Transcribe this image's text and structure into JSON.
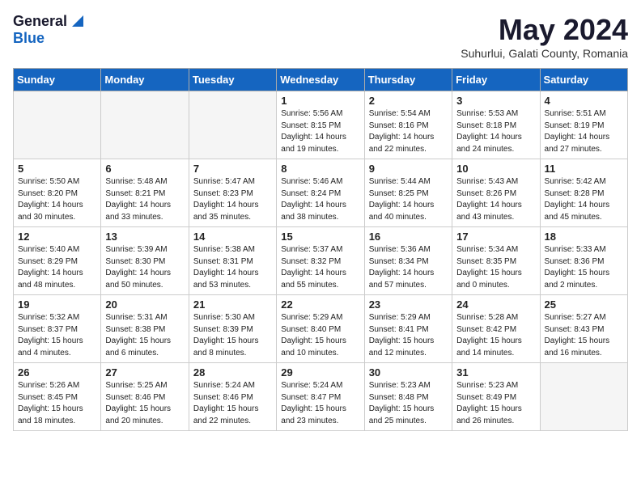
{
  "logo": {
    "general": "General",
    "blue": "Blue"
  },
  "title": "May 2024",
  "location": "Suhurlui, Galati County, Romania",
  "days_of_week": [
    "Sunday",
    "Monday",
    "Tuesday",
    "Wednesday",
    "Thursday",
    "Friday",
    "Saturday"
  ],
  "weeks": [
    [
      {
        "num": "",
        "info": ""
      },
      {
        "num": "",
        "info": ""
      },
      {
        "num": "",
        "info": ""
      },
      {
        "num": "1",
        "info": "Sunrise: 5:56 AM\nSunset: 8:15 PM\nDaylight: 14 hours\nand 19 minutes."
      },
      {
        "num": "2",
        "info": "Sunrise: 5:54 AM\nSunset: 8:16 PM\nDaylight: 14 hours\nand 22 minutes."
      },
      {
        "num": "3",
        "info": "Sunrise: 5:53 AM\nSunset: 8:18 PM\nDaylight: 14 hours\nand 24 minutes."
      },
      {
        "num": "4",
        "info": "Sunrise: 5:51 AM\nSunset: 8:19 PM\nDaylight: 14 hours\nand 27 minutes."
      }
    ],
    [
      {
        "num": "5",
        "info": "Sunrise: 5:50 AM\nSunset: 8:20 PM\nDaylight: 14 hours\nand 30 minutes."
      },
      {
        "num": "6",
        "info": "Sunrise: 5:48 AM\nSunset: 8:21 PM\nDaylight: 14 hours\nand 33 minutes."
      },
      {
        "num": "7",
        "info": "Sunrise: 5:47 AM\nSunset: 8:23 PM\nDaylight: 14 hours\nand 35 minutes."
      },
      {
        "num": "8",
        "info": "Sunrise: 5:46 AM\nSunset: 8:24 PM\nDaylight: 14 hours\nand 38 minutes."
      },
      {
        "num": "9",
        "info": "Sunrise: 5:44 AM\nSunset: 8:25 PM\nDaylight: 14 hours\nand 40 minutes."
      },
      {
        "num": "10",
        "info": "Sunrise: 5:43 AM\nSunset: 8:26 PM\nDaylight: 14 hours\nand 43 minutes."
      },
      {
        "num": "11",
        "info": "Sunrise: 5:42 AM\nSunset: 8:28 PM\nDaylight: 14 hours\nand 45 minutes."
      }
    ],
    [
      {
        "num": "12",
        "info": "Sunrise: 5:40 AM\nSunset: 8:29 PM\nDaylight: 14 hours\nand 48 minutes."
      },
      {
        "num": "13",
        "info": "Sunrise: 5:39 AM\nSunset: 8:30 PM\nDaylight: 14 hours\nand 50 minutes."
      },
      {
        "num": "14",
        "info": "Sunrise: 5:38 AM\nSunset: 8:31 PM\nDaylight: 14 hours\nand 53 minutes."
      },
      {
        "num": "15",
        "info": "Sunrise: 5:37 AM\nSunset: 8:32 PM\nDaylight: 14 hours\nand 55 minutes."
      },
      {
        "num": "16",
        "info": "Sunrise: 5:36 AM\nSunset: 8:34 PM\nDaylight: 14 hours\nand 57 minutes."
      },
      {
        "num": "17",
        "info": "Sunrise: 5:34 AM\nSunset: 8:35 PM\nDaylight: 15 hours\nand 0 minutes."
      },
      {
        "num": "18",
        "info": "Sunrise: 5:33 AM\nSunset: 8:36 PM\nDaylight: 15 hours\nand 2 minutes."
      }
    ],
    [
      {
        "num": "19",
        "info": "Sunrise: 5:32 AM\nSunset: 8:37 PM\nDaylight: 15 hours\nand 4 minutes."
      },
      {
        "num": "20",
        "info": "Sunrise: 5:31 AM\nSunset: 8:38 PM\nDaylight: 15 hours\nand 6 minutes."
      },
      {
        "num": "21",
        "info": "Sunrise: 5:30 AM\nSunset: 8:39 PM\nDaylight: 15 hours\nand 8 minutes."
      },
      {
        "num": "22",
        "info": "Sunrise: 5:29 AM\nSunset: 8:40 PM\nDaylight: 15 hours\nand 10 minutes."
      },
      {
        "num": "23",
        "info": "Sunrise: 5:29 AM\nSunset: 8:41 PM\nDaylight: 15 hours\nand 12 minutes."
      },
      {
        "num": "24",
        "info": "Sunrise: 5:28 AM\nSunset: 8:42 PM\nDaylight: 15 hours\nand 14 minutes."
      },
      {
        "num": "25",
        "info": "Sunrise: 5:27 AM\nSunset: 8:43 PM\nDaylight: 15 hours\nand 16 minutes."
      }
    ],
    [
      {
        "num": "26",
        "info": "Sunrise: 5:26 AM\nSunset: 8:45 PM\nDaylight: 15 hours\nand 18 minutes."
      },
      {
        "num": "27",
        "info": "Sunrise: 5:25 AM\nSunset: 8:46 PM\nDaylight: 15 hours\nand 20 minutes."
      },
      {
        "num": "28",
        "info": "Sunrise: 5:24 AM\nSunset: 8:46 PM\nDaylight: 15 hours\nand 22 minutes."
      },
      {
        "num": "29",
        "info": "Sunrise: 5:24 AM\nSunset: 8:47 PM\nDaylight: 15 hours\nand 23 minutes."
      },
      {
        "num": "30",
        "info": "Sunrise: 5:23 AM\nSunset: 8:48 PM\nDaylight: 15 hours\nand 25 minutes."
      },
      {
        "num": "31",
        "info": "Sunrise: 5:23 AM\nSunset: 8:49 PM\nDaylight: 15 hours\nand 26 minutes."
      },
      {
        "num": "",
        "info": ""
      }
    ]
  ]
}
